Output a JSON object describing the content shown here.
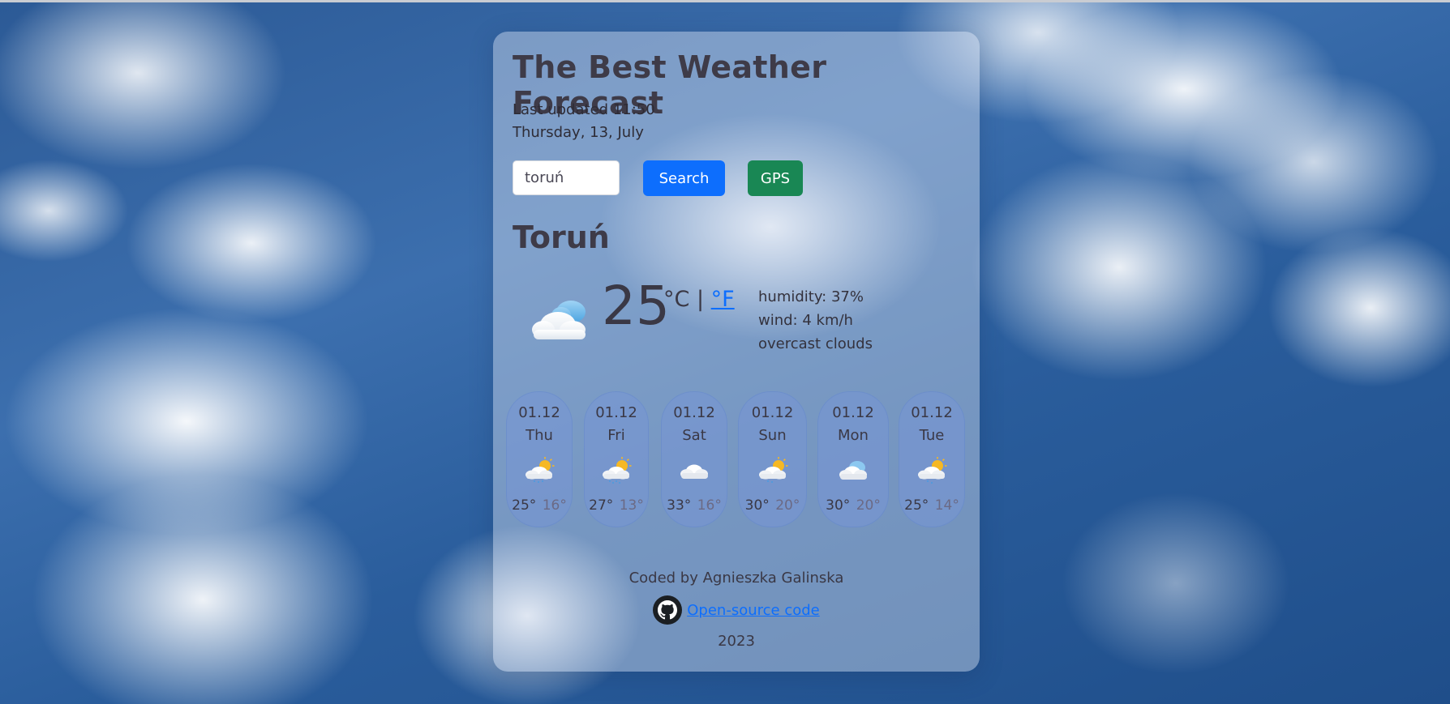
{
  "app": {
    "title": "The Best Weather Forecast",
    "last_updated": "Last updated 11:50",
    "date": "Thursday, 13, July"
  },
  "search": {
    "value": "toruń",
    "button_label": "Search",
    "gps_label": "GPS"
  },
  "current": {
    "city": "Toruń",
    "temperature": "25",
    "unit_c": "°C",
    "separator": "|",
    "unit_f": "°F",
    "humidity": "humidity: 37%",
    "wind": "wind: 4 km/h",
    "description": "overcast clouds",
    "icon": "cloud-sun-icon"
  },
  "forecast": [
    {
      "date": "01.12",
      "day": "Thu",
      "max": "25°",
      "min": "16°",
      "icon": "sun-cloud-rain-icon"
    },
    {
      "date": "01.12",
      "day": "Fri",
      "max": "27°",
      "min": "13°",
      "icon": "sun-cloud-rain-icon"
    },
    {
      "date": "01.12",
      "day": "Sat",
      "max": "33°",
      "min": "16°",
      "icon": "cloud-icon"
    },
    {
      "date": "01.12",
      "day": "Sun",
      "max": "30°",
      "min": "20°",
      "icon": "sun-cloud-rain-icon"
    },
    {
      "date": "01.12",
      "day": "Mon",
      "max": "30°",
      "min": "20°",
      "icon": "cloud-blue-icon"
    },
    {
      "date": "01.12",
      "day": "Tue",
      "max": "25°",
      "min": "14°",
      "icon": "sun-cloud-rain-icon"
    }
  ],
  "footer": {
    "credit": "Coded by Agnieszka Galinska",
    "link_label": "Open-source code",
    "year": "2023"
  },
  "colors": {
    "primary": "#0d6efd",
    "success": "#198754",
    "card": "#e1e8f5"
  }
}
